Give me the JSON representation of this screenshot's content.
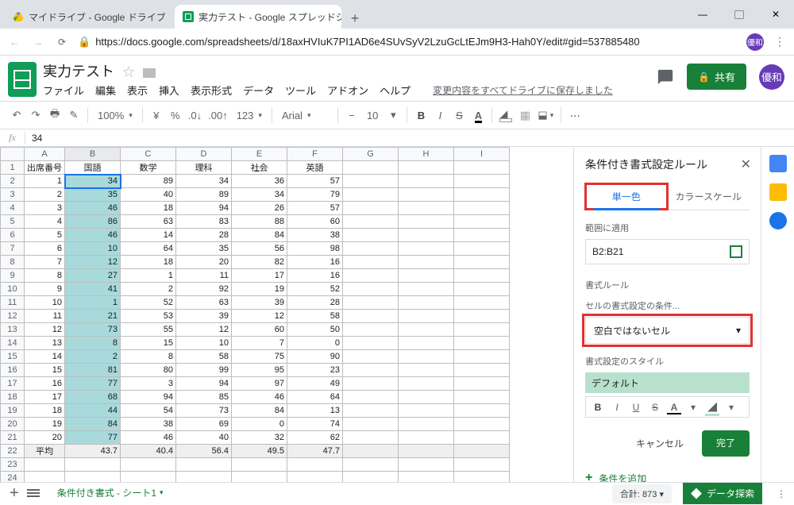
{
  "browser": {
    "tabs": [
      {
        "title": "マイドライブ - Google ドライブ",
        "type": "drive"
      },
      {
        "title": "実力テスト - Google スプレッドシート",
        "type": "sheets"
      }
    ],
    "url": "https://docs.google.com/spreadsheets/d/18axHVIuK7PI1AD6e4SUvSyV2LzuGcLtEJm9H3-Hah0Y/edit#gid=537885480",
    "avatar": "優和"
  },
  "doc": {
    "title": "実力テスト",
    "menus": [
      "ファイル",
      "編集",
      "表示",
      "挿入",
      "表示形式",
      "データ",
      "ツール",
      "アドオン",
      "ヘルプ"
    ],
    "save_msg": "変更内容をすべてドライブに保存しました",
    "share": "共有",
    "avatar": "優和"
  },
  "toolbar": {
    "zoom": "100%",
    "currency": "¥",
    "percent": "%",
    "dec_dec": ".0",
    "dec_inc": ".00",
    "fmt": "123",
    "font": "Arial",
    "size": "10"
  },
  "fx": {
    "value": "34"
  },
  "sheet": {
    "columns": [
      "A",
      "B",
      "C",
      "D",
      "E",
      "F",
      "G",
      "H",
      "I"
    ],
    "headers": [
      "出席番号",
      "国語",
      "数学",
      "理科",
      "社会",
      "英語"
    ],
    "rows": [
      [
        1,
        34,
        89,
        34,
        36,
        57
      ],
      [
        2,
        35,
        40,
        89,
        34,
        79
      ],
      [
        3,
        46,
        18,
        94,
        26,
        57
      ],
      [
        4,
        86,
        63,
        83,
        88,
        60
      ],
      [
        5,
        46,
        14,
        28,
        84,
        38
      ],
      [
        6,
        10,
        64,
        35,
        56,
        98
      ],
      [
        7,
        12,
        18,
        20,
        82,
        16
      ],
      [
        8,
        27,
        1,
        11,
        17,
        16
      ],
      [
        9,
        41,
        2,
        92,
        19,
        52
      ],
      [
        10,
        1,
        52,
        63,
        39,
        28
      ],
      [
        11,
        21,
        53,
        39,
        12,
        58
      ],
      [
        12,
        73,
        55,
        12,
        60,
        50
      ],
      [
        13,
        8,
        15,
        10,
        7,
        0
      ],
      [
        14,
        2,
        8,
        58,
        75,
        90
      ],
      [
        15,
        81,
        80,
        99,
        95,
        23
      ],
      [
        16,
        77,
        3,
        94,
        97,
        49
      ],
      [
        17,
        68,
        94,
        85,
        46,
        64
      ],
      [
        18,
        44,
        54,
        73,
        84,
        13
      ],
      [
        19,
        84,
        38,
        69,
        0,
        74
      ],
      [
        20,
        77,
        46,
        40,
        32,
        62
      ]
    ],
    "avg_label": "平均",
    "avg": [
      43.7,
      40.4,
      56.4,
      49.5,
      47.7
    ],
    "highlight_col": 1
  },
  "side": {
    "title": "条件付き書式設定ルール",
    "tab_single": "単一色",
    "tab_scale": "カラースケール",
    "apply_to_label": "範囲に適用",
    "range": "B2:B21",
    "rules_label": "書式ルール",
    "cond_label": "セルの書式設定の条件...",
    "cond_value": "空白ではないセル",
    "style_label": "書式設定のスタイル",
    "style_name": "デフォルト",
    "cancel": "キャンセル",
    "done": "完了",
    "add_rule": "条件を追加"
  },
  "bottom": {
    "sheet_tab": "条件付き書式 - シート1",
    "sum_label": "合計:",
    "sum_value": "873",
    "explore": "データ探索"
  }
}
